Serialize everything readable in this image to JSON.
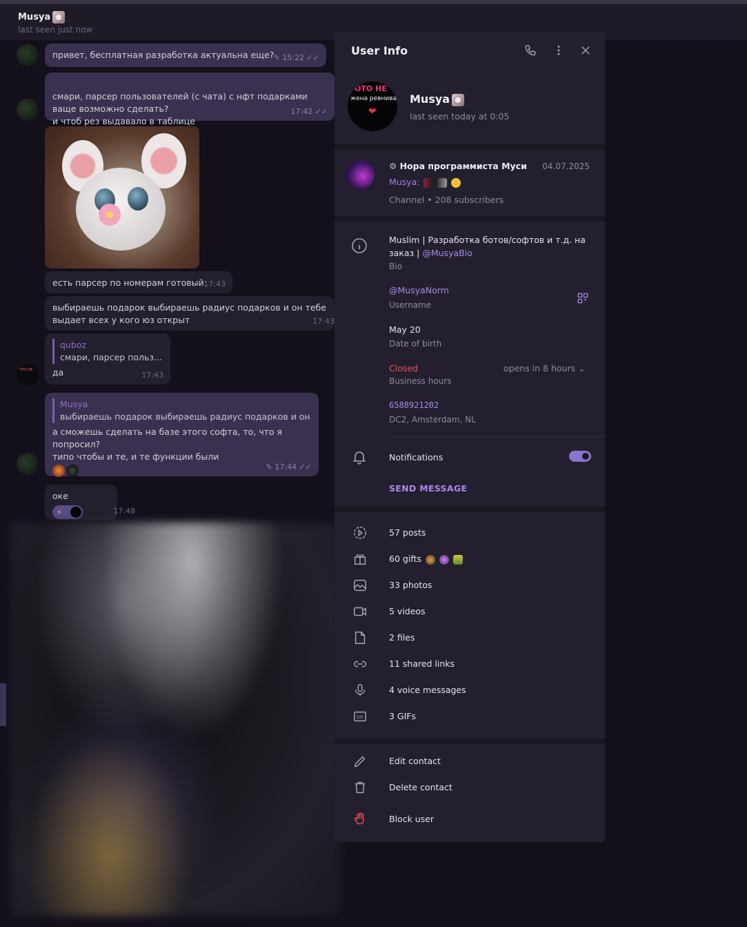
{
  "chat": {
    "name": "Musya",
    "status": "last seen just now",
    "messages": [
      {
        "text": "привет, бесплатная разработка актуальна еще?",
        "time": "15:22"
      },
      {
        "text": "смари, парсер пользователей (с чата) с нфт подарками ваще возможно сделать?\nи чтоб рез выдавало в таблице",
        "time": "17:42"
      },
      {
        "text": "есть парсер по номерам готовый",
        "time": "17:43"
      },
      {
        "text": "выбираешь подарок выбираешь радиус подарков и он тебе выдает всех у кого юз открыт",
        "time": "17:43"
      },
      {
        "reply_name": "quboz",
        "reply_text": "смари, парсер польз...",
        "text": "да",
        "time": "17:43"
      },
      {
        "reply_name": "Musya",
        "reply_text": "выбираешь подарок выбираешь радиус подарков и он...",
        "text": "а сможешь сделать на базе этого софта, то, что я попросил?\nтипо чтобы и те, и те функции были",
        "time": "17:44"
      },
      {
        "text": "оке",
        "time": "17:48"
      }
    ]
  },
  "panel": {
    "title": "User Info",
    "name": "Musya",
    "last_seen": "last seen today at 0:05",
    "avatar_text_top": "ОТО НЕ",
    "avatar_text_mid": "жена ревнивая.",
    "channel": {
      "title": "Нора программиста Муси",
      "date": "04.07.2025",
      "last_msg_author": "Musya:",
      "meta": "Channel • 208 subscribers"
    },
    "bio": {
      "text": "Muslim | Разработка ботов/софтов и т.д. на заказ |",
      "link": "@MusyaBio",
      "label": "Bio"
    },
    "username": {
      "value": "@MusyaNorm",
      "label": "Username"
    },
    "birthday": {
      "value": "May 20",
      "label": "Date of birth"
    },
    "business_hours": {
      "status": "Closed",
      "label": "Business hours",
      "opens": "opens in 8 hours"
    },
    "phone": {
      "value": "6588921202",
      "location": "DC2, Amsterdam, NL"
    },
    "notifications_label": "Notifications",
    "notifications_on": true,
    "send_message": "SEND MESSAGE",
    "media": [
      {
        "icon": "stories-icon",
        "label": "57 posts"
      },
      {
        "icon": "gift-icon",
        "label": "60 gifts"
      },
      {
        "icon": "photo-icon",
        "label": "33 photos"
      },
      {
        "icon": "video-icon",
        "label": "5 videos"
      },
      {
        "icon": "file-icon",
        "label": "2 files"
      },
      {
        "icon": "link-icon",
        "label": "11 shared links"
      },
      {
        "icon": "microphone-icon",
        "label": "4 voice messages"
      },
      {
        "icon": "gif-icon",
        "label": "3 GIFs"
      }
    ],
    "actions": {
      "edit": "Edit contact",
      "delete": "Delete contact",
      "block": "Block user"
    }
  },
  "colors": {
    "accent": "#a78ae8",
    "danger": "#f04a56",
    "panel_bg": "#241f2e",
    "chat_bg": "#130f1b"
  }
}
